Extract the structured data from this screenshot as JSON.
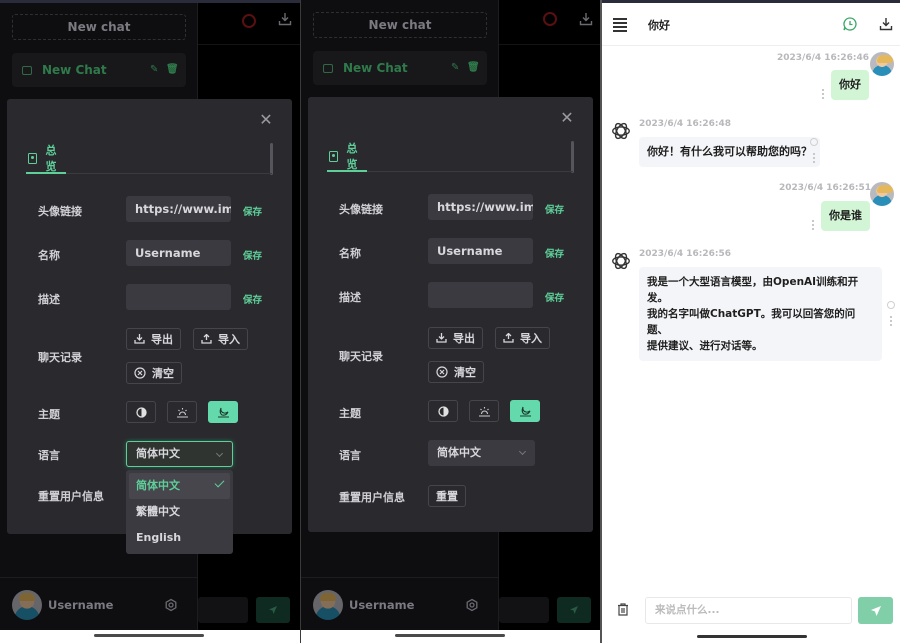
{
  "sidebar": {
    "new_chat_label": "New chat",
    "chat_item_title": "New Chat",
    "username": "Username"
  },
  "settings": {
    "tab_label": "总览",
    "avatar_label": "头像链接",
    "avatar_value": "https://www.im",
    "name_label": "名称",
    "name_value": "Username",
    "desc_label": "描述",
    "desc_value": "",
    "save_label": "保存",
    "history_label": "聊天记录",
    "export_label": "导出",
    "import_label": "导入",
    "clear_label": "清空",
    "theme_label": "主题",
    "theme_options": [
      "auto",
      "light",
      "dark"
    ],
    "theme_active": "dark",
    "language_label": "语言",
    "language_value": "简体中文",
    "language_options": [
      "简体中文",
      "繁體中文",
      "English"
    ],
    "reset_label": "重置用户信息",
    "reset_button": "重置"
  },
  "chat": {
    "title": "你好",
    "input_placeholder": "来说点什么...",
    "messages": [
      {
        "role": "user",
        "time": "2023/6/4 16:26:46",
        "text": "你好"
      },
      {
        "role": "assistant",
        "time": "2023/6/4 16:26:48",
        "text": "你好！有什么我可以帮助您的吗？"
      },
      {
        "role": "user",
        "time": "2023/6/4 16:26:51",
        "text": "你是谁"
      },
      {
        "role": "assistant",
        "time": "2023/6/4 16:26:56",
        "lines": [
          "我是一个大型语言模型，由OpenAI训练和开发。",
          "我的名字叫做ChatGPT。我可以回答您的问题、",
          "提供建议、进行对话等。"
        ]
      }
    ]
  },
  "colors": {
    "accent": "#5fcf9a",
    "user_bubble": "#d2f5d6",
    "bot_bubble": "#f4f5f8",
    "send_button": "#80cfa9"
  }
}
